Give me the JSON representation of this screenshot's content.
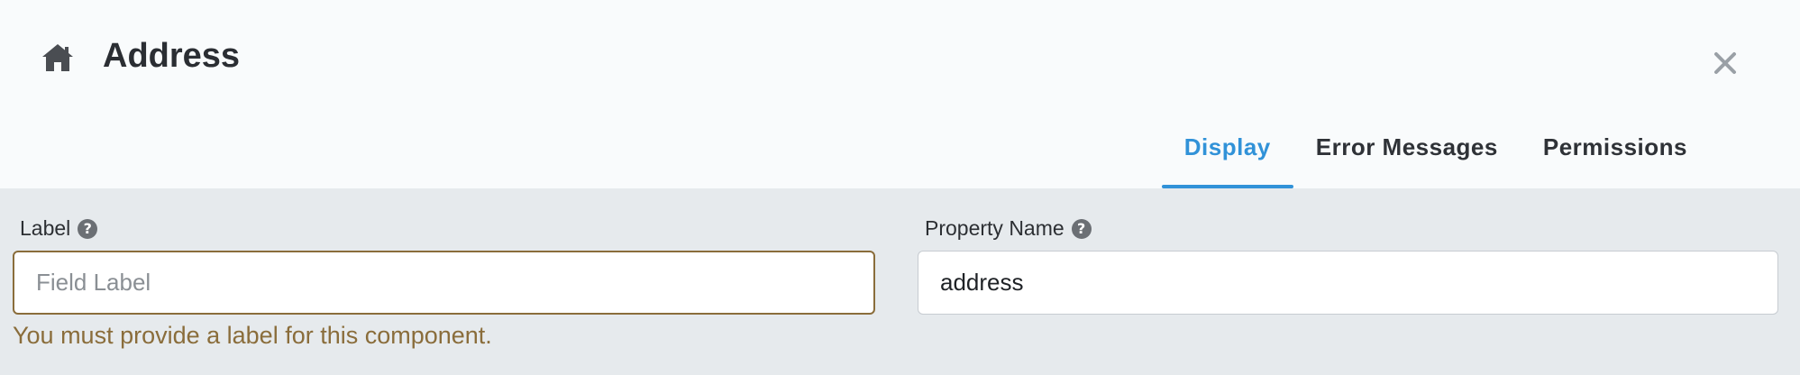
{
  "header": {
    "title": "Address",
    "home_icon": "home-icon",
    "close_icon": "close-icon"
  },
  "tabs": [
    {
      "label": "Display",
      "active": true
    },
    {
      "label": "Error Messages",
      "active": false
    },
    {
      "label": "Permissions",
      "active": false
    }
  ],
  "fields": {
    "label": {
      "label": "Label",
      "value": "",
      "placeholder": "Field Label",
      "error": "You must provide a label for this component."
    },
    "property_name": {
      "label": "Property Name",
      "value": "address",
      "placeholder": ""
    }
  },
  "colors": {
    "accent": "#3192d8",
    "error": "#8a6d3b"
  }
}
